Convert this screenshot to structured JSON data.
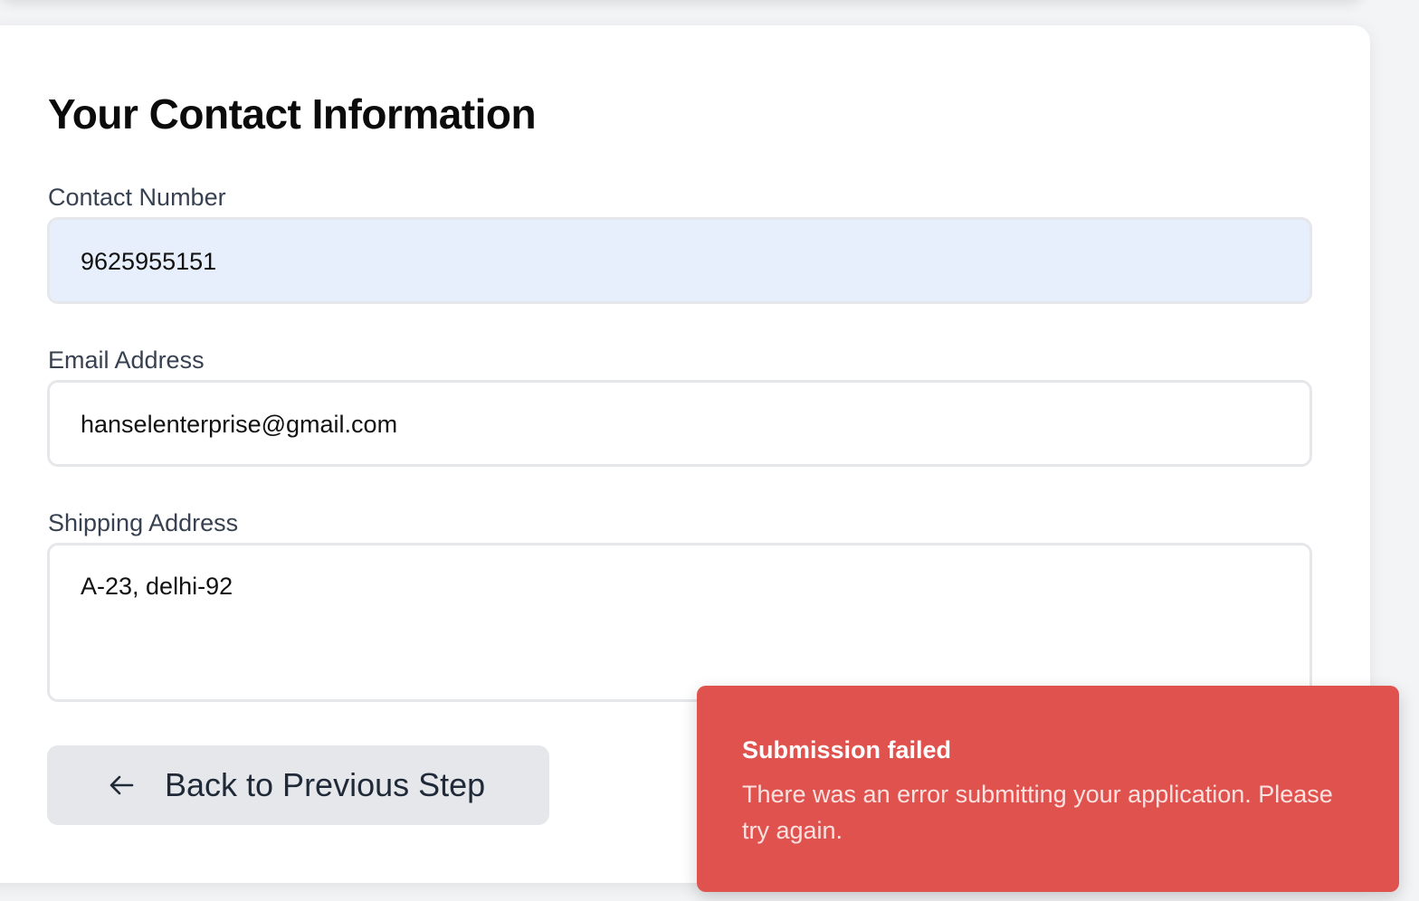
{
  "form": {
    "title": "Your Contact Information",
    "contact_number": {
      "label": "Contact Number",
      "value": "9625955151"
    },
    "email": {
      "label": "Email Address",
      "value": "hanselenterprise@gmail.com"
    },
    "shipping": {
      "label": "Shipping Address",
      "value": "A-23, delhi-92"
    },
    "back_button": {
      "label": "Back to Previous Step",
      "icon": "arrow-left-icon"
    }
  },
  "toast": {
    "title": "Submission failed",
    "message": "There was an error submitting your application. Please try again.",
    "color": "#df524e"
  },
  "colors": {
    "autofill_background": "#e8effc",
    "button_background": "#e5e7eb"
  }
}
